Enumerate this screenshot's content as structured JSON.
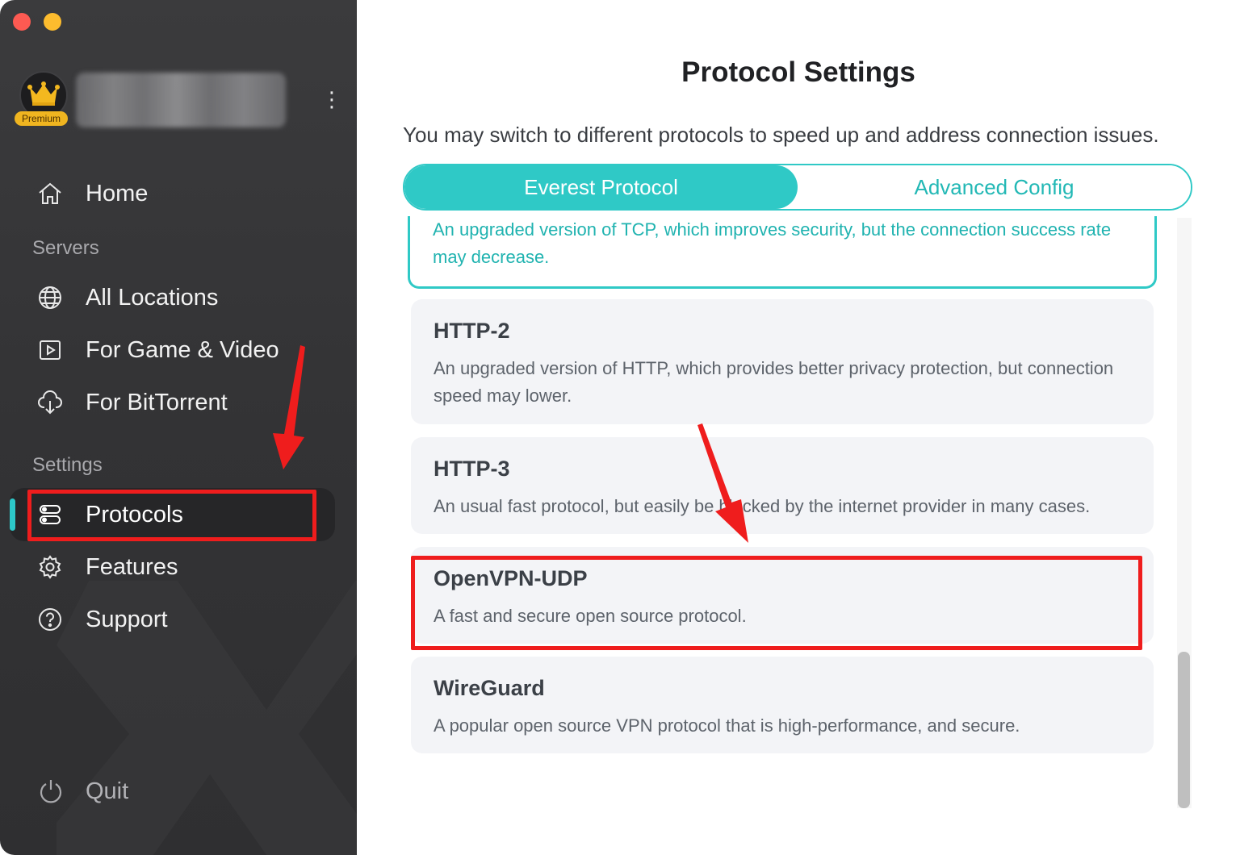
{
  "sidebar": {
    "premium_badge": "Premium",
    "nav_home": "Home",
    "section_servers": "Servers",
    "nav_all_locations": "All Locations",
    "nav_game_video": "For Game & Video",
    "nav_bittorrent": "For BitTorrent",
    "section_settings": "Settings",
    "nav_protocols": "Protocols",
    "nav_features": "Features",
    "nav_support": "Support",
    "nav_quit": "Quit"
  },
  "main": {
    "title": "Protocol Settings",
    "subtitle": "You may switch to different protocols to speed up and address connection issues.",
    "tabs": [
      {
        "label": "Everest Protocol",
        "active": true
      },
      {
        "label": "Advanced Config",
        "active": false
      }
    ],
    "protocols": [
      {
        "title": "",
        "description": "An upgraded version of TCP, which improves security, but the connection success rate may decrease.",
        "selected": true
      },
      {
        "title": "HTTP-2",
        "description": "An upgraded version of HTTP, which provides better privacy protection, but connection speed may lower."
      },
      {
        "title": "HTTP-3",
        "description": "An usual fast protocol, but easily be blocked by the internet provider in many cases."
      },
      {
        "title": "OpenVPN-UDP",
        "description": "A fast and secure open source protocol."
      },
      {
        "title": "WireGuard",
        "description": "A popular open source VPN protocol that is high-performance, and secure."
      }
    ]
  },
  "colors": {
    "accent": "#2fc9c6",
    "sidebar_bg": "#333335",
    "annotation_red": "#ef1d1d"
  }
}
